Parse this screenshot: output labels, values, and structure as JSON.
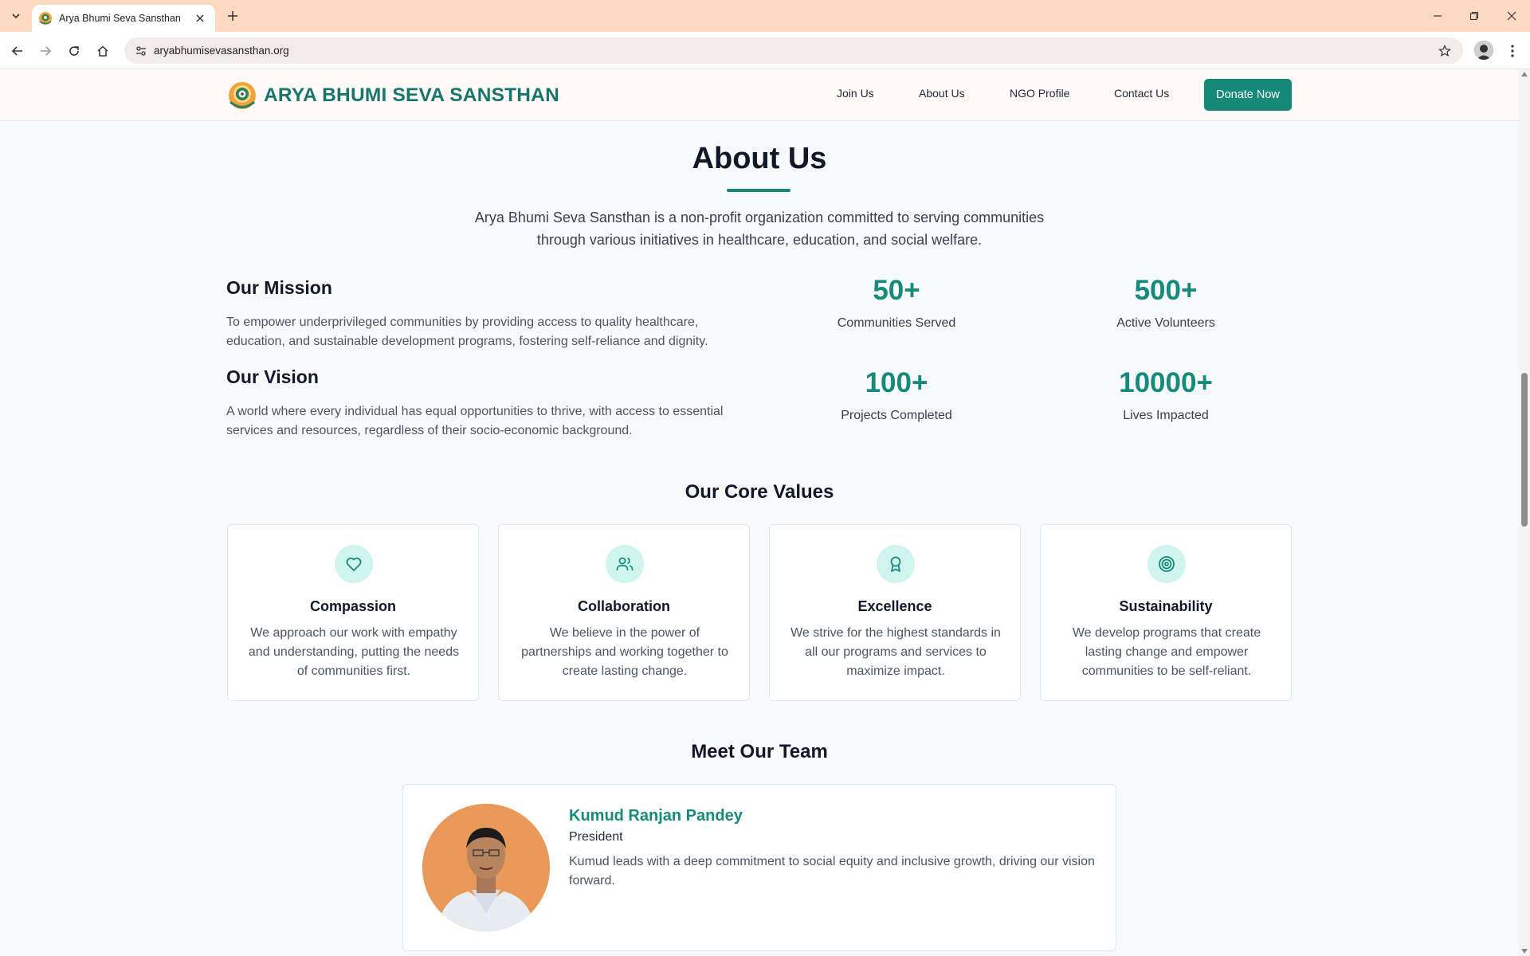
{
  "browser": {
    "tab_title": "Arya Bhumi Seva Sansthan",
    "url": "aryabhumisevasansthan.org"
  },
  "header": {
    "brand": "ARYA BHUMI SEVA SANSTHAN",
    "nav": [
      "Join Us",
      "About Us",
      "NGO Profile",
      "Contact Us"
    ],
    "donate_label": "Donate Now"
  },
  "about": {
    "title": "About Us",
    "intro": "Arya Bhumi Seva Sansthan is a non-profit organization committed to serving communities through various initiatives in healthcare, education, and social welfare.",
    "mission": {
      "title": "Our Mission",
      "text": "To empower underprivileged communities by providing access to quality healthcare, education, and sustainable development programs, fostering self-reliance and dignity."
    },
    "vision": {
      "title": "Our Vision",
      "text": "A world where every individual has equal opportunities to thrive, with access to essential services and resources, regardless of their socio-economic background."
    },
    "stats": [
      {
        "value": "50+",
        "label": "Communities Served"
      },
      {
        "value": "500+",
        "label": "Active Volunteers"
      },
      {
        "value": "100+",
        "label": "Projects Completed"
      },
      {
        "value": "10000+",
        "label": "Lives Impacted"
      }
    ]
  },
  "core_values": {
    "title": "Our Core Values",
    "items": [
      {
        "icon": "heart-icon",
        "title": "Compassion",
        "text": "We approach our work with empathy and understanding, putting the needs of communities first."
      },
      {
        "icon": "users-icon",
        "title": "Collaboration",
        "text": "We believe in the power of partnerships and working together to create lasting change."
      },
      {
        "icon": "award-icon",
        "title": "Excellence",
        "text": "We strive for the highest standards in all our programs and services to maximize impact."
      },
      {
        "icon": "target-icon",
        "title": "Sustainability",
        "text": "We develop programs that create lasting change and empower communities to be self-reliant."
      }
    ]
  },
  "team": {
    "title": "Meet Our Team",
    "members": [
      {
        "name": "Kumud Ranjan Pandey",
        "role": "President",
        "bio": "Kumud leads with a deep commitment to social equity and inclusive growth, driving our vision forward."
      }
    ]
  },
  "colors": {
    "accent": "#168a7b",
    "tabstrip": "#fcd9c1",
    "icon_bg": "#cff5ee"
  }
}
